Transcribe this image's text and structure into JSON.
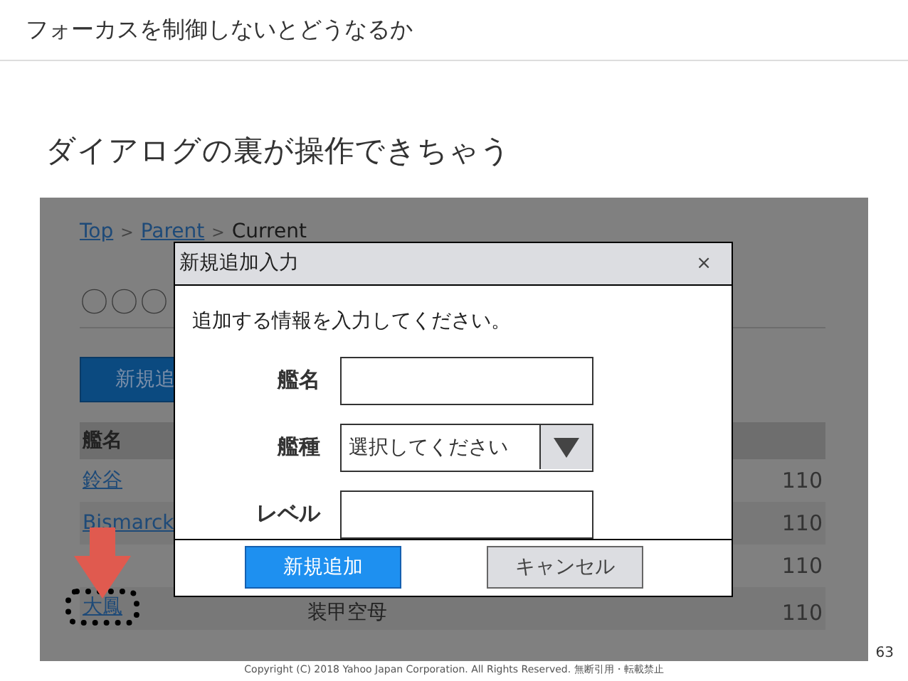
{
  "slide": {
    "title": "フォーカスを制御しないとどうなるか",
    "heading": "ダイアログの裏が操作できちゃう",
    "copyright": "Copyright (C) 2018 Yahoo Japan Corporation. All Rights Reserved. 無断引用・転載禁止",
    "page_number": "63"
  },
  "background_page": {
    "breadcrumb": [
      {
        "label": "Top",
        "kind": "link"
      },
      {
        "label": ">",
        "kind": "separator"
      },
      {
        "label": "Parent",
        "kind": "link"
      },
      {
        "label": ">",
        "kind": "separator"
      },
      {
        "label": "Current",
        "kind": "text"
      }
    ],
    "page_title": "〇〇〇",
    "add_button": "新規追",
    "column_1": "艦名",
    "rows": [
      {
        "name": "鈴谷",
        "value": "110",
        "highlighted": false
      },
      {
        "name": "Bismarck",
        "value": "110",
        "highlighted": false
      },
      {
        "value": "110",
        "highlighted": false
      },
      {
        "name": "大鳳",
        "type": "装甲空母",
        "value": "110",
        "highlighted": true
      }
    ]
  },
  "dialog": {
    "title": "新規追加入力",
    "close": "×",
    "message": "追加する情報を入力してください。",
    "fields": [
      {
        "label": "艦名",
        "kind": "text"
      },
      {
        "label": "艦種",
        "kind": "select",
        "placeholder": "選択してください"
      },
      {
        "label": "レベル",
        "kind": "text"
      }
    ],
    "buttons": [
      {
        "label": "新規追加",
        "kind": "primary"
      },
      {
        "label": "キャンセル",
        "kind": "secondary"
      }
    ]
  }
}
